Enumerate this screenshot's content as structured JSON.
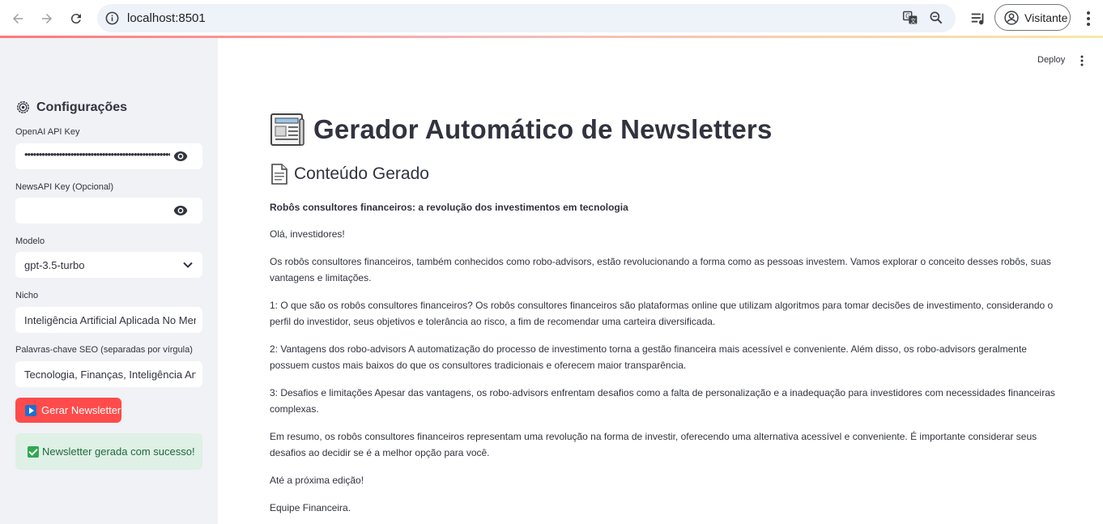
{
  "browser": {
    "url": "localhost:8501",
    "profile_label": "Visitante"
  },
  "sidebar": {
    "title": "Configurações",
    "openai_label": "OpenAI API Key",
    "openai_value": "••••••••••••••••••••••••••••••••••••••••••••••••••••",
    "newsapi_label": "NewsAPI Key (Opcional)",
    "newsapi_value": "",
    "model_label": "Modelo",
    "model_value": "gpt-3.5-turbo",
    "niche_label": "Nicho",
    "niche_value": "Inteligência Artificial Aplicada No Mercado",
    "seo_label": "Palavras-chave SEO (separadas por vírgula)",
    "seo_value": "Tecnologia, Finanças, Inteligência Artificial",
    "generate_button": "Gerar Newsletter",
    "success_message": "Newsletter gerada com sucesso!"
  },
  "header": {
    "deploy_label": "Deploy"
  },
  "main": {
    "title": "Gerador Automático de Newsletters",
    "subtitle": "Conteúdo Gerado",
    "headline": "Robôs consultores financeiros: a revolução dos investimentos em tecnologia",
    "paragraphs": [
      "Olá, investidores!",
      "Os robôs consultores financeiros, também conhecidos como robo-advisors, estão revolucionando a forma como as pessoas investem. Vamos explorar o conceito desses robôs, suas vantagens e limitações.",
      "1: O que são os robôs consultores financeiros? Os robôs consultores financeiros são plataformas online que utilizam algoritmos para tomar decisões de investimento, considerando o perfil do investidor, seus objetivos e tolerância ao risco, a fim de recomendar uma carteira diversificada.",
      "2: Vantagens dos robo-advisors A automatização do processo de investimento torna a gestão financeira mais acessível e conveniente. Além disso, os robo-advisors geralmente possuem custos mais baixos do que os consultores tradicionais e oferecem maior transparência.",
      "3: Desafios e limitações Apesar das vantagens, os robo-advisors enfrentam desafios como a falta de personalização e a inadequação para investidores com necessidades financeiras complexas.",
      "Em resumo, os robôs consultores financeiros representam uma revolução na forma de investir, oferecendo uma alternativa acessível e conveniente. É importante considerar seus desafios ao decidir se é a melhor opção para você.",
      "Até a próxima edição!",
      "Equipe Financeira."
    ]
  }
}
